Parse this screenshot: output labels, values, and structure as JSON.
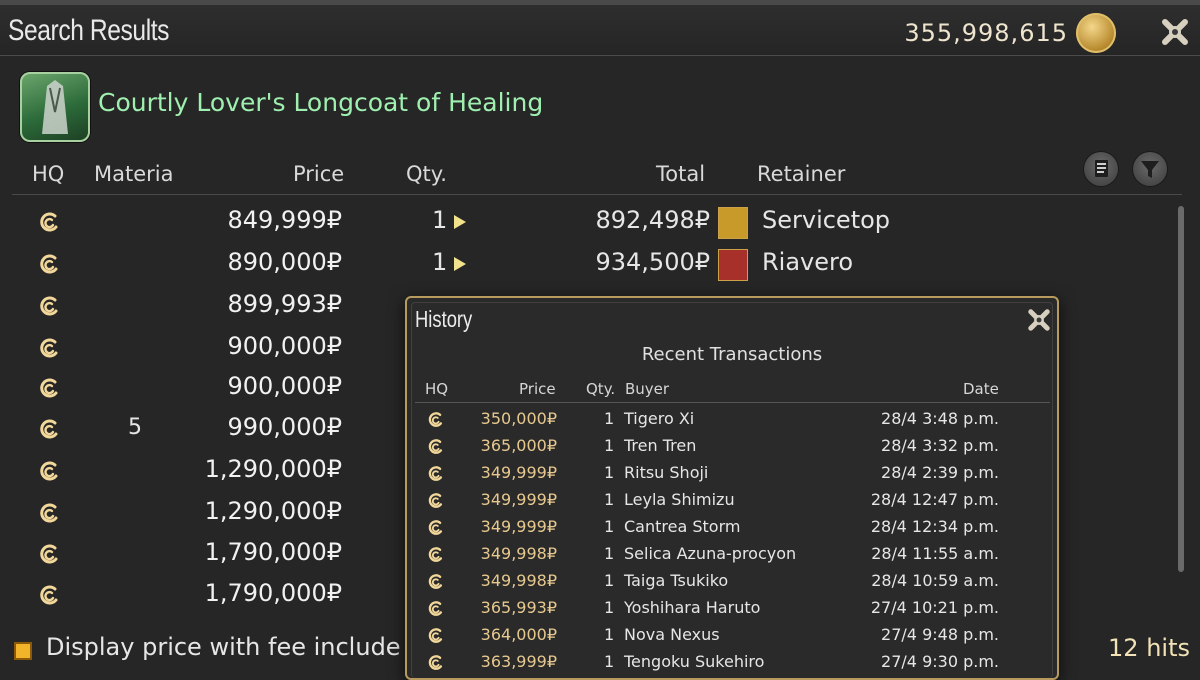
{
  "window": {
    "title": "Search Results",
    "gil": "355,998,615"
  },
  "item": {
    "name": "Courtly Lover's Longcoat of Healing"
  },
  "columns": {
    "hq": "HQ",
    "materia": "Materia",
    "price": "Price",
    "qty": "Qty.",
    "total": "Total",
    "retainer": "Retainer"
  },
  "listings": [
    {
      "materia": "",
      "price": "849,999₽",
      "qty": "1",
      "total": "892,498₽",
      "retainer": "Servicetop"
    },
    {
      "materia": "",
      "price": "890,000₽",
      "qty": "1",
      "total": "934,500₽",
      "retainer": "Riavero"
    },
    {
      "materia": "",
      "price": "899,993₽",
      "qty": "",
      "total": "",
      "retainer": ""
    },
    {
      "materia": "",
      "price": "900,000₽",
      "qty": "",
      "total": "",
      "retainer": ""
    },
    {
      "materia": "",
      "price": "900,000₽",
      "qty": "",
      "total": "",
      "retainer": ""
    },
    {
      "materia": "5",
      "price": "990,000₽",
      "qty": "",
      "total": "",
      "retainer": ""
    },
    {
      "materia": "",
      "price": "1,290,000₽",
      "qty": "",
      "total": "",
      "retainer": ""
    },
    {
      "materia": "",
      "price": "1,290,000₽",
      "qty": "",
      "total": "",
      "retainer": ""
    },
    {
      "materia": "",
      "price": "1,790,000₽",
      "qty": "",
      "total": "",
      "retainer": ""
    },
    {
      "materia": "",
      "price": "1,790,000₽",
      "qty": "",
      "total": "",
      "retainer": ""
    }
  ],
  "footer": {
    "checkbox_label": "Display price with fee include",
    "hits": "12 hits"
  },
  "history": {
    "title": "History",
    "subtitle": "Recent Transactions",
    "columns": {
      "hq": "HQ",
      "price": "Price",
      "qty": "Qty.",
      "buyer": "Buyer",
      "date": "Date"
    },
    "rows": [
      {
        "price": "350,000₽",
        "qty": "1",
        "buyer": "Tigero Xi",
        "date": "28/4 3:48 p.m."
      },
      {
        "price": "365,000₽",
        "qty": "1",
        "buyer": "Tren Tren",
        "date": "28/4 3:32 p.m."
      },
      {
        "price": "349,999₽",
        "qty": "1",
        "buyer": "Ritsu Shoji",
        "date": "28/4 2:39 p.m."
      },
      {
        "price": "349,999₽",
        "qty": "1",
        "buyer": "Leyla Shimizu",
        "date": "28/4 12:47 p.m."
      },
      {
        "price": "349,999₽",
        "qty": "1",
        "buyer": "Cantrea Storm",
        "date": "28/4 12:34 p.m."
      },
      {
        "price": "349,998₽",
        "qty": "1",
        "buyer": "Selica Azuna-procyon",
        "date": "28/4 11:55 a.m."
      },
      {
        "price": "349,998₽",
        "qty": "1",
        "buyer": "Taiga Tsukiko",
        "date": "28/4 10:59 a.m."
      },
      {
        "price": "365,993₽",
        "qty": "1",
        "buyer": "Yoshihara Haruto",
        "date": "27/4 10:21 p.m."
      },
      {
        "price": "364,000₽",
        "qty": "1",
        "buyer": "Nova Nexus",
        "date": "27/4 9:48 p.m."
      },
      {
        "price": "363,999₽",
        "qty": "1",
        "buyer": "Tengoku Sukehiro",
        "date": "27/4 9:30 p.m."
      }
    ]
  },
  "icons": {
    "hq": "hq-icon",
    "gil_coin": "gil-coin-icon",
    "close": "close-icon",
    "list_view": "list-view-icon",
    "filter": "filter-icon",
    "retainer_menu": "arrow-right-icon"
  },
  "colors": {
    "item_name": "#9ff0b0",
    "popup_border": "#b79a5d",
    "checkbox": "#f1b42a",
    "hq": "#f2d79a"
  }
}
